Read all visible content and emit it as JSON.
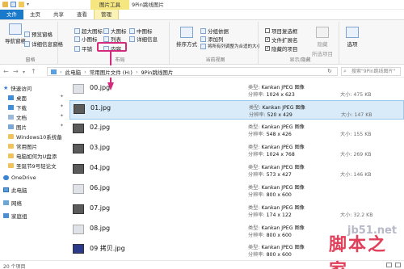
{
  "title_bar": {
    "context_tab": "图片工具",
    "window_title": "9Pin跳线图片"
  },
  "tabs": [
    {
      "label": "文件"
    },
    {
      "label": "主页"
    },
    {
      "label": "共享"
    },
    {
      "label": "查看"
    },
    {
      "label": "管理"
    }
  ],
  "ribbon": {
    "pane_group": {
      "label": "窗格",
      "nav_pane": "导航窗格",
      "preview_pane": "预览窗格",
      "details_pane": "详细信息窗格"
    },
    "layout_group": {
      "label": "布局",
      "extra_large": "超大图标",
      "large": "大图标",
      "medium": "中图标",
      "small": "小图标",
      "list": "列表",
      "details": "详细信息",
      "tiles": "平铺",
      "content": "内容"
    },
    "current_view_group": {
      "label": "当前视图",
      "sort": "排序方式",
      "group_by": "分组依据",
      "add_columns": "添加列",
      "size_all_columns": "将所有列调整为合适的大小"
    },
    "show_hide_group": {
      "label": "显示/隐藏",
      "item_checkboxes": "项目复选框",
      "file_extensions": "文件扩展名",
      "hidden_items": "隐藏的项目",
      "hide_selected": "隐藏",
      "hide_selected_2": "所选项目"
    },
    "options": {
      "label": "选项"
    }
  },
  "address": {
    "crumbs": [
      "此电脑",
      "常用图片文件 (H:)",
      "9Pin跳线图片"
    ],
    "search_placeholder": "搜索\"9Pin跳线图片\""
  },
  "nav": {
    "items": [
      {
        "label": "快速访问",
        "icon": "star-icon"
      },
      {
        "label": "桌面",
        "icon": "desktop-icon"
      },
      {
        "label": "下载",
        "icon": "download-icon"
      },
      {
        "label": "文档",
        "icon": "document-icon"
      },
      {
        "label": "图片",
        "icon": "picture-icon"
      },
      {
        "label": "Windows10系统备",
        "icon": "folder-icon"
      },
      {
        "label": "常用图片",
        "icon": "folder-icon"
      },
      {
        "label": "电脑如何为U盘添",
        "icon": "folder-icon"
      },
      {
        "label": "圣诞节9号轻论文",
        "icon": "folder-icon"
      },
      {
        "label": "OneDrive",
        "icon": "cloud-icon"
      },
      {
        "label": "此电脑",
        "icon": "pc-icon"
      },
      {
        "label": "网络",
        "icon": "network-icon"
      },
      {
        "label": "家庭组",
        "icon": "homegroup-icon"
      }
    ]
  },
  "files": [
    {
      "name": "00.jpg",
      "type": "Kankan JPEG 图像",
      "dims": "1024 x 623",
      "size": "475 KB",
      "type_label": "类型:",
      "dims_label": "分辨率:",
      "size_label": "大小:"
    },
    {
      "name": "01.jpg",
      "type": "Kankan JPEG 图像",
      "dims": "520 x 429",
      "size": "147 KB",
      "type_label": "类型:",
      "dims_label": "分辨率:",
      "size_label": "大小:"
    },
    {
      "name": "02.jpg",
      "type": "Kankan JPEG 图像",
      "dims": "548 x 426",
      "size": "155 KB",
      "type_label": "类型:",
      "dims_label": "分辨率:",
      "size_label": "大小:"
    },
    {
      "name": "03.jpg",
      "type": "Kankan JPEG 图像",
      "dims": "1024 x 768",
      "size": "269 KB",
      "type_label": "类型:",
      "dims_label": "分辨率:",
      "size_label": "大小:"
    },
    {
      "name": "04.jpg",
      "type": "Kankan JPEG 图像",
      "dims": "573 x 427",
      "size": "146 KB",
      "type_label": "类型:",
      "dims_label": "分辨率:",
      "size_label": "大小:"
    },
    {
      "name": "06.jpg",
      "type": "Kankan JPEG 图像",
      "dims": "800 x 600",
      "size": "",
      "type_label": "类型:",
      "dims_label": "分辨率:",
      "size_label": "大小:"
    },
    {
      "name": "07.jpg",
      "type": "Kankan JPEG 图像",
      "dims": "174 x 122",
      "size": "32.2 KB",
      "type_label": "类型:",
      "dims_label": "分辨率:",
      "size_label": "大小:"
    },
    {
      "name": "08.jpg",
      "type": "Kankan JPEG 图像",
      "dims": "800 x 600",
      "size": "",
      "type_label": "类型:",
      "dims_label": "分辨率:",
      "size_label": "大小:"
    },
    {
      "name": "09 拷贝.jpg",
      "type": "Kankan JPEG 图像",
      "dims": "800 x 600",
      "size": "",
      "type_label": "类型:",
      "dims_label": "分辨率:",
      "size_label": "大小:"
    }
  ],
  "status": {
    "text": "20 个项目"
  },
  "watermark": {
    "domain": "jb51.net",
    "site_name": "脚本之家"
  }
}
